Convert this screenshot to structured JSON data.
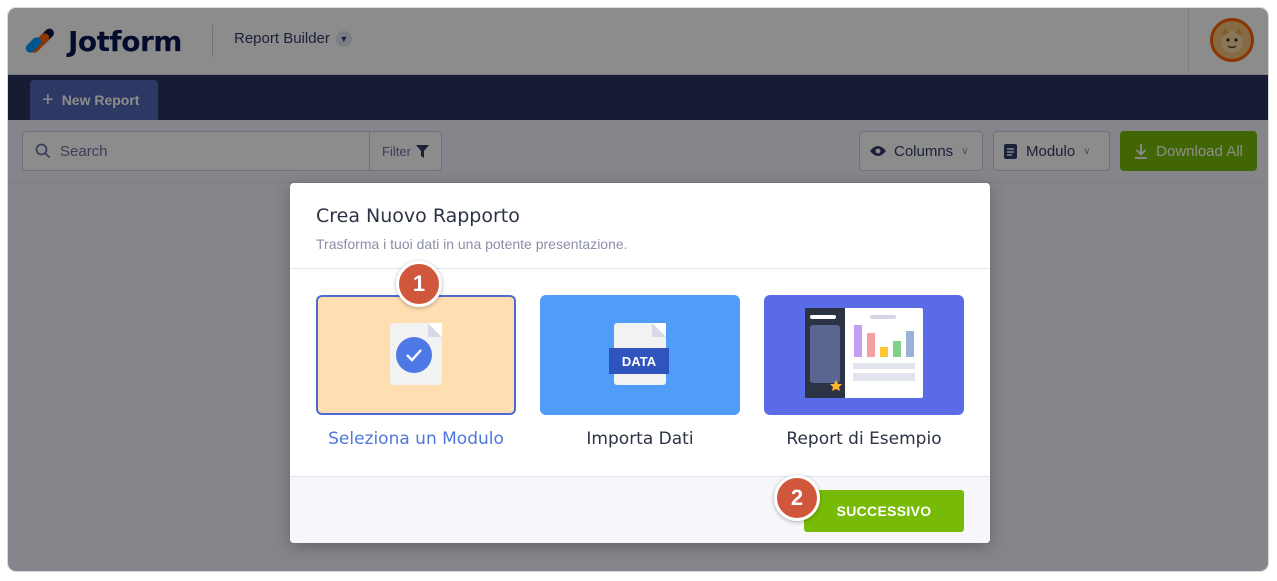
{
  "header": {
    "brand": "Jotform",
    "app_switcher": "Report Builder"
  },
  "nav": {
    "new_report": "New Report"
  },
  "toolbar": {
    "search_placeholder": "Search",
    "filter": "Filter",
    "columns": "Columns",
    "modulo": "Modulo",
    "download_all": "Download All"
  },
  "modal": {
    "title": "Crea Nuovo Rapporto",
    "subtitle": "Trasforma i tuoi dati in una potente presentazione.",
    "options": [
      {
        "label": "Seleziona un Modulo",
        "selected": true
      },
      {
        "label": "Importa Dati",
        "tag": "DATA"
      },
      {
        "label": "Report di Esempio"
      }
    ],
    "next_button": "SUCCESSIVO"
  },
  "callouts": {
    "step_1": "1",
    "step_2": "2"
  },
  "colors": {
    "accent_green": "#78bb07",
    "nav_dark": "#2a3462",
    "callout_red": "#d0573b",
    "selected_option_bg": "#ffdfb2"
  }
}
